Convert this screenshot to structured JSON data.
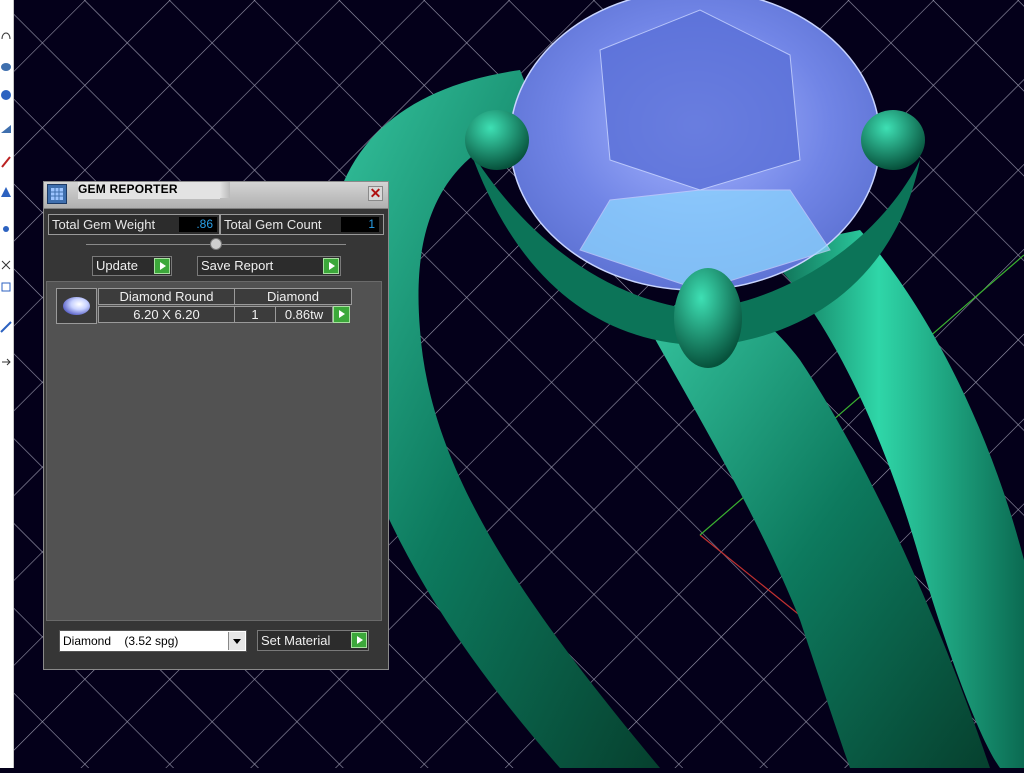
{
  "gem_reporter": {
    "title": "GEM REPORTER",
    "close_glyph": "✕",
    "total_weight_label": "Total Gem Weight",
    "total_weight_value": ".86",
    "total_count_label": "Total Gem Count",
    "total_count_value": "1",
    "update_label": "Update",
    "save_report_label": "Save Report",
    "table": {
      "headers": [
        "Diamond Round",
        "Diamond"
      ],
      "row": {
        "size": "6.20 X 6.20",
        "count": "1",
        "weight": "0.86tw"
      }
    },
    "material_select_value": "Diamond    (3.52 spg)",
    "set_material_label": "Set Material"
  },
  "colors": {
    "viewport_bg": "#04001a",
    "grid": "#d8d8e8",
    "ring_green": "#0f8a6a",
    "gem_blue": "#7a8ee8",
    "accent_green_button": "#3ca83a",
    "value_text": "#2aa0e8"
  },
  "icons": {
    "panel_icon": "gem-reporter-icon",
    "close": "close-icon",
    "arrow": "play-arrow-icon",
    "dropdown": "chevron-down-icon"
  }
}
